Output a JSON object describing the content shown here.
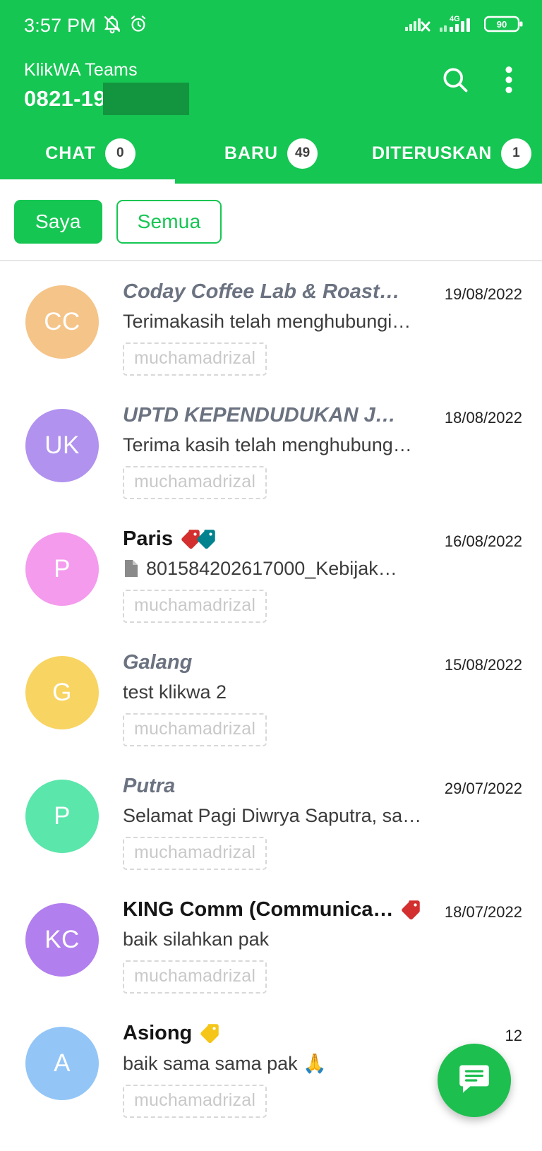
{
  "statusbar": {
    "time": "3:57 PM",
    "icons_left": [
      "bell-muted-icon",
      "alarm-clock-icon"
    ],
    "icons_right": [
      "signal-no-sim-icon",
      "signal-4g-icon",
      "battery-icon"
    ],
    "network_label": "4G",
    "battery_level": "90"
  },
  "header": {
    "subtitle": "KlikWA Teams",
    "phone": "0821-19",
    "phone_redacted": true,
    "search_icon": "search-icon",
    "menu_icon": "overflow-menu-icon",
    "accent_color": "#16C653"
  },
  "tabs": [
    {
      "label": "CHAT",
      "badge": "0",
      "active": true
    },
    {
      "label": "BARU",
      "badge": "49",
      "active": false
    },
    {
      "label": "DITERUSKAN",
      "badge": "1",
      "active": false
    }
  ],
  "filters": [
    {
      "label": "Saya",
      "active": true
    },
    {
      "label": "Semua",
      "active": false
    }
  ],
  "chats": [
    {
      "name": "Coday Coffee Lab & Roastery",
      "initials": "CC",
      "avatar_color": "#F5C489",
      "preview": "Terimakasih telah menghubungi…",
      "date": "19/08/2022",
      "agent": "muchamadrizal",
      "unread": false,
      "labels": [],
      "doc_icon": false
    },
    {
      "name": "UPTD KEPENDUDUKAN JP....",
      "initials": "UK",
      "avatar_color": "#B192EF",
      "preview": "Terima kasih telah menghubung…",
      "date": "18/08/2022",
      "agent": "muchamadrizal",
      "unread": false,
      "labels": [],
      "doc_icon": false
    },
    {
      "name": "Paris",
      "initials": "P",
      "avatar_color": "#F49BEE",
      "preview": "801584202617000_Kebijak…",
      "date": "16/08/2022",
      "agent": "muchamadrizal",
      "unread": true,
      "labels": [
        "#D32F2F",
        "#00838F"
      ],
      "doc_icon": true
    },
    {
      "name": "Galang",
      "initials": "G",
      "avatar_color": "#F8D462",
      "preview": "test klikwa 2",
      "date": "15/08/2022",
      "agent": "muchamadrizal",
      "unread": false,
      "labels": [],
      "doc_icon": false
    },
    {
      "name": "Putra",
      "initials": "P",
      "avatar_color": "#5BE6AB",
      "preview": "Selamat Pagi Diwrya Saputra, sa…",
      "date": "29/07/2022",
      "agent": "muchamadrizal",
      "unread": false,
      "labels": [],
      "doc_icon": false
    },
    {
      "name": "KING Comm (Communica…",
      "initials": "KC",
      "avatar_color": "#B27FEE",
      "preview": "baik silahkan pak",
      "date": "18/07/2022",
      "agent": "muchamadrizal",
      "unread": true,
      "labels": [
        "#D32F2F"
      ],
      "doc_icon": false
    },
    {
      "name": "Asiong",
      "initials": "A",
      "avatar_color": "#93C5F7",
      "preview": "baik sama sama pak 🙏",
      "date": "12",
      "agent": "muchamadrizal",
      "unread": true,
      "labels": [
        "#F5C518"
      ],
      "doc_icon": false
    }
  ],
  "fab": {
    "icon": "new-chat-icon",
    "color": "#1DBF4F"
  }
}
